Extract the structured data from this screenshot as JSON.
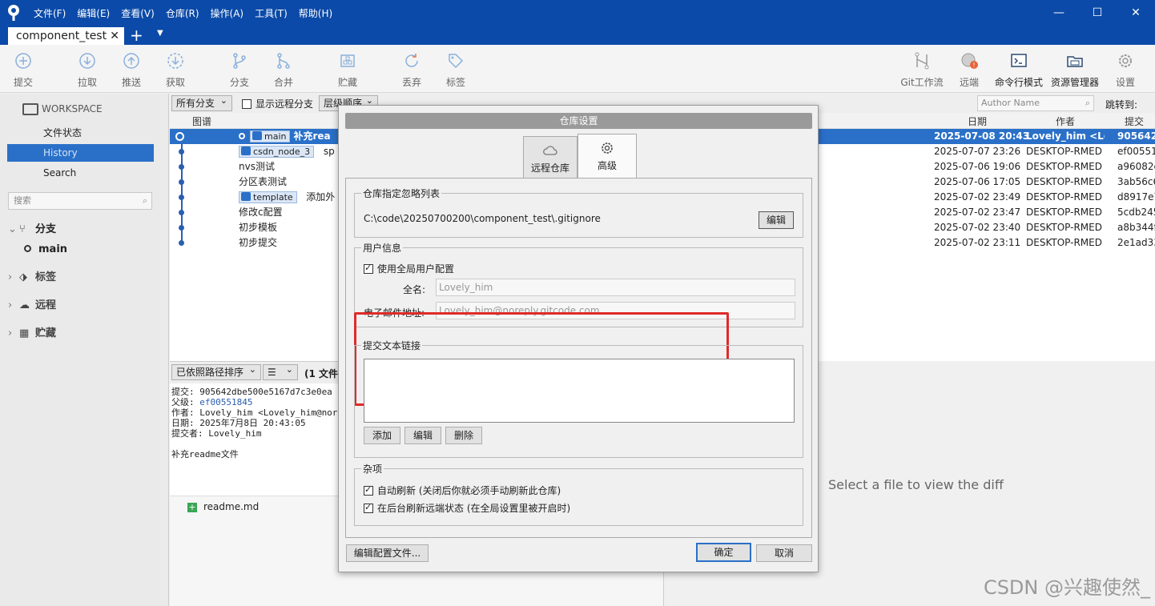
{
  "menus": [
    "文件(F)",
    "编辑(E)",
    "查看(V)",
    "仓库(R)",
    "操作(A)",
    "工具(T)",
    "帮助(H)"
  ],
  "window": {
    "minimize": "—",
    "maximize": "☐",
    "close": "✕"
  },
  "tab": {
    "label": "component_test",
    "close": "✕",
    "add": "+",
    "dropdown": "▼"
  },
  "toolbar": {
    "commit": "提交",
    "pull": "拉取",
    "push": "推送",
    "fetch": "获取",
    "branch": "分支",
    "merge": "合并",
    "stash": "贮藏",
    "discard": "丢弃",
    "tag": "标签",
    "gitflow": "Git工作流",
    "remote": "远端",
    "terminal": "命令行模式",
    "explorer": "资源管理器",
    "settings": "设置"
  },
  "sidebar": {
    "workspace": "WORKSPACE",
    "items": [
      "文件状态",
      "History",
      "Search"
    ],
    "search_placeholder": "搜索",
    "branches": "分支",
    "current_branch": "main",
    "tags": "标签",
    "remotes": "远程",
    "stashes": "贮藏"
  },
  "filterbar": {
    "all_branches": "所有分支",
    "show_remote": "显示远程分支",
    "order": "层级顺序",
    "author_placeholder": "Author Name",
    "jump_to": "跳转到:"
  },
  "columns": {
    "graph": "图谱",
    "date": "日期",
    "author": "作者",
    "commit": "提交"
  },
  "commits": [
    {
      "tags": [
        "main"
      ],
      "msg": "补充rea",
      "date": "2025-07-08 20:43",
      "author": "Lovely_him <Lo",
      "hash": "905642d"
    },
    {
      "tags": [
        "csdn_node_3"
      ],
      "msg": "sp",
      "date": "2025-07-07 23:26",
      "author": "DESKTOP-RMED",
      "hash": "ef00551"
    },
    {
      "tags": [],
      "msg": "nvs测试",
      "date": "2025-07-06 19:06",
      "author": "DESKTOP-RMED",
      "hash": "a96082e"
    },
    {
      "tags": [],
      "msg": "分区表测试",
      "date": "2025-07-06 17:05",
      "author": "DESKTOP-RMED",
      "hash": "3ab56c6"
    },
    {
      "tags": [
        "template"
      ],
      "msg": "添加外",
      "date": "2025-07-02 23:49",
      "author": "DESKTOP-RMED",
      "hash": "d8917e7"
    },
    {
      "tags": [],
      "msg": "修改c配置",
      "date": "2025-07-02 23:47",
      "author": "DESKTOP-RMED",
      "hash": "5cdb245"
    },
    {
      "tags": [],
      "msg": "初步模板",
      "date": "2025-07-02 23:40",
      "author": "DESKTOP-RMED",
      "hash": "a8b344f"
    },
    {
      "tags": [],
      "msg": "初步提交",
      "date": "2025-07-02 23:11",
      "author": "DESKTOP-RMED",
      "hash": "2e1ad33"
    }
  ],
  "lower": {
    "sort": "已依照路径排序",
    "view": "☰",
    "count": "(1 文件)",
    "detail_lines": {
      "commit": "提交: 905642dbe500e5167d7c3e0ea",
      "parent_label": "父级: ",
      "parent_hash": "ef00551845",
      "author": "作者: Lovely_him <Lovely_him@nor",
      "date": "日期: 2025年7月8日 20:43:05",
      "committer": "提交者: Lovely_him",
      "message": "补充readme文件"
    },
    "file": "readme.md",
    "diff_placeholder": "Select a file to view the diff"
  },
  "watermark": "CSDN @兴趣使然_",
  "dialog": {
    "title": "仓库设置",
    "tab_remote": "远程仓库",
    "tab_advanced": "高级",
    "ignore_group": "仓库指定忽略列表",
    "ignore_path": "C:\\code\\20250700200\\component_test\\.gitignore",
    "edit_btn": "编辑",
    "user_group": "用户信息",
    "use_global": "使用全局用户配置",
    "fullname_label": "全名:",
    "fullname_value": "Lovely_him",
    "email_label": "电子邮件地址:",
    "email_value": "Lovely_him@noreply.gitcode.com",
    "links_group": "提交文本链接",
    "add_btn": "添加",
    "edit2_btn": "编辑",
    "delete_btn": "删除",
    "misc_group": "杂项",
    "auto_refresh": "自动刷新 (关闭后你就必须手动刷新此仓库)",
    "bg_refresh": "在后台刷新远端状态 (在全局设置里被开启时)",
    "edit_config": "编辑配置文件...",
    "ok": "确定",
    "cancel": "取消"
  },
  "colors": {
    "titlebar": "#0b4aa8",
    "selection": "#2a70c8",
    "highlight": "#e02a2a"
  }
}
